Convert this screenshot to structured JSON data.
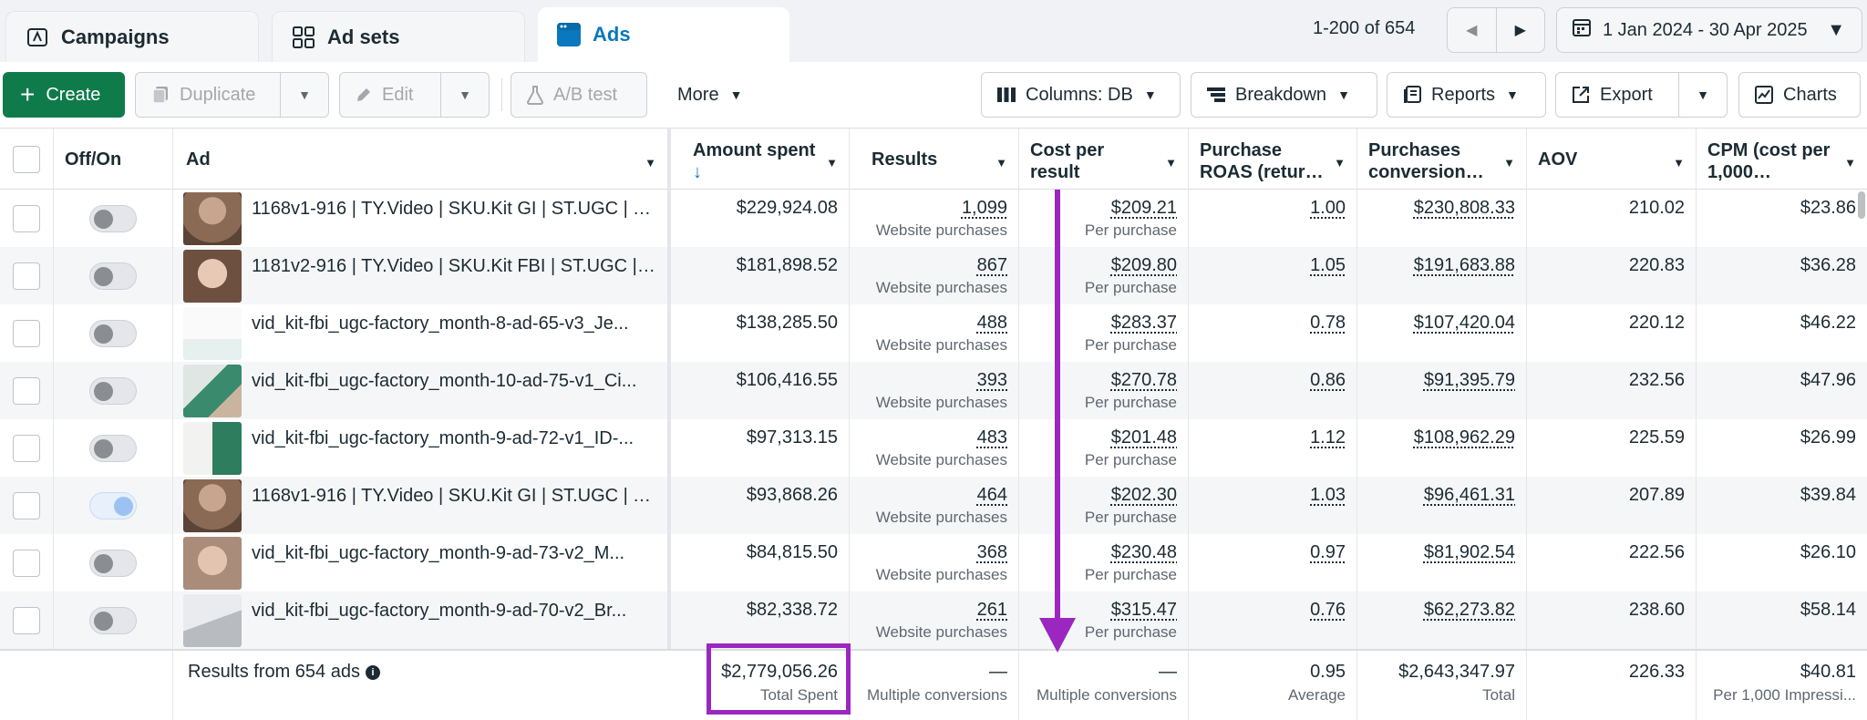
{
  "tabs": [
    {
      "label": "Campaigns",
      "icon": "campaign-flag-icon",
      "active": false
    },
    {
      "label": "Ad sets",
      "icon": "grid-icon",
      "active": false
    },
    {
      "label": "Ads",
      "icon": "ad-window-icon",
      "active": true
    }
  ],
  "pager": {
    "text": "1-200 of 654"
  },
  "date_range": {
    "label": "1 Jan 2024 - 30 Apr 2025"
  },
  "toolbar": {
    "create": "Create",
    "duplicate": "Duplicate",
    "edit": "Edit",
    "ab_test": "A/B test",
    "more": "More",
    "columns": "Columns: DB",
    "breakdown": "Breakdown",
    "reports": "Reports",
    "export": "Export",
    "charts": "Charts"
  },
  "columns": {
    "off_on": "Off/On",
    "ad": "Ad",
    "amount_spent": "Amount spent",
    "results": "Results",
    "cost_per_result_1": "Cost per",
    "cost_per_result_2": "result",
    "roas_1": "Purchase",
    "roas_2": "ROAS (retur…",
    "purchases_1": "Purchases",
    "purchases_2": "conversion…",
    "aov": "AOV",
    "cpm_1": "CPM (cost per",
    "cpm_2": "1,000…"
  },
  "rows": [
    {
      "on": false,
      "ad": "1168v1-916 | TY.Video | SKU.Kit GI | ST.UGC | TI...",
      "spent": "$229,924.08",
      "results": "1,099",
      "results_type": "Website purchases",
      "cpr": "$209.21",
      "cpr_type": "Per purchase",
      "roas": "1.00",
      "purchases": "$230,808.33",
      "aov": "210.02",
      "cpm": "$23.86"
    },
    {
      "on": false,
      "ad": "1181v2-916 | TY.Video | SKU.Kit FBI | ST.UGC | T...",
      "spent": "$181,898.52",
      "results": "867",
      "results_type": "Website purchases",
      "cpr": "$209.80",
      "cpr_type": "Per purchase",
      "roas": "1.05",
      "purchases": "$191,683.88",
      "aov": "220.83",
      "cpm": "$36.28"
    },
    {
      "on": false,
      "ad": "vid_kit-fbi_ugc-factory_month-8-ad-65-v3_Je...",
      "spent": "$138,285.50",
      "results": "488",
      "results_type": "Website purchases",
      "cpr": "$283.37",
      "cpr_type": "Per purchase",
      "roas": "0.78",
      "purchases": "$107,420.04",
      "aov": "220.12",
      "cpm": "$46.22"
    },
    {
      "on": false,
      "ad": "vid_kit-fbi_ugc-factory_month-10-ad-75-v1_Ci...",
      "spent": "$106,416.55",
      "results": "393",
      "results_type": "Website purchases",
      "cpr": "$270.78",
      "cpr_type": "Per purchase",
      "roas": "0.86",
      "purchases": "$91,395.79",
      "aov": "232.56",
      "cpm": "$47.96"
    },
    {
      "on": false,
      "ad": "vid_kit-fbi_ugc-factory_month-9-ad-72-v1_ID-...",
      "spent": "$97,313.15",
      "results": "483",
      "results_type": "Website purchases",
      "cpr": "$201.48",
      "cpr_type": "Per purchase",
      "roas": "1.12",
      "purchases": "$108,962.29",
      "aov": "225.59",
      "cpm": "$26.99"
    },
    {
      "on": true,
      "ad": "1168v1-916 | TY.Video | SKU.Kit GI | ST.UGC | TI...",
      "spent": "$93,868.26",
      "results": "464",
      "results_type": "Website purchases",
      "cpr": "$202.30",
      "cpr_type": "Per purchase",
      "roas": "1.03",
      "purchases": "$96,461.31",
      "aov": "207.89",
      "cpm": "$39.84"
    },
    {
      "on": false,
      "ad": "vid_kit-fbi_ugc-factory_month-9-ad-73-v2_M...",
      "spent": "$84,815.50",
      "results": "368",
      "results_type": "Website purchases",
      "cpr": "$230.48",
      "cpr_type": "Per purchase",
      "roas": "0.97",
      "purchases": "$81,902.54",
      "aov": "222.56",
      "cpm": "$26.10"
    },
    {
      "on": false,
      "ad": "vid_kit-fbi_ugc-factory_month-9-ad-70-v2_Br...",
      "spent": "$82,338.72",
      "results": "261",
      "results_type": "Website purchases",
      "cpr": "$315.47",
      "cpr_type": "Per purchase",
      "roas": "0.76",
      "purchases": "$62,273.82",
      "aov": "238.60",
      "cpm": "$58.14"
    }
  ],
  "footer": {
    "results_label": "Results from 654 ads",
    "spent": "$2,779,056.26",
    "spent_sub": "Total Spent",
    "results": "—",
    "results_sub": "Multiple conversions",
    "cpr": "—",
    "cpr_sub": "Multiple conversions",
    "roas": "0.95",
    "roas_sub": "Average",
    "purchases": "$2,643,347.97",
    "purchases_sub": "Total",
    "aov": "226.33",
    "cpm": "$40.81",
    "cpm_sub": "Per 1,000 Impressi..."
  },
  "colors": {
    "accent_blue": "#0a78be",
    "create_green": "#0f7b4b",
    "annotation_purple": "#9b27c0"
  }
}
